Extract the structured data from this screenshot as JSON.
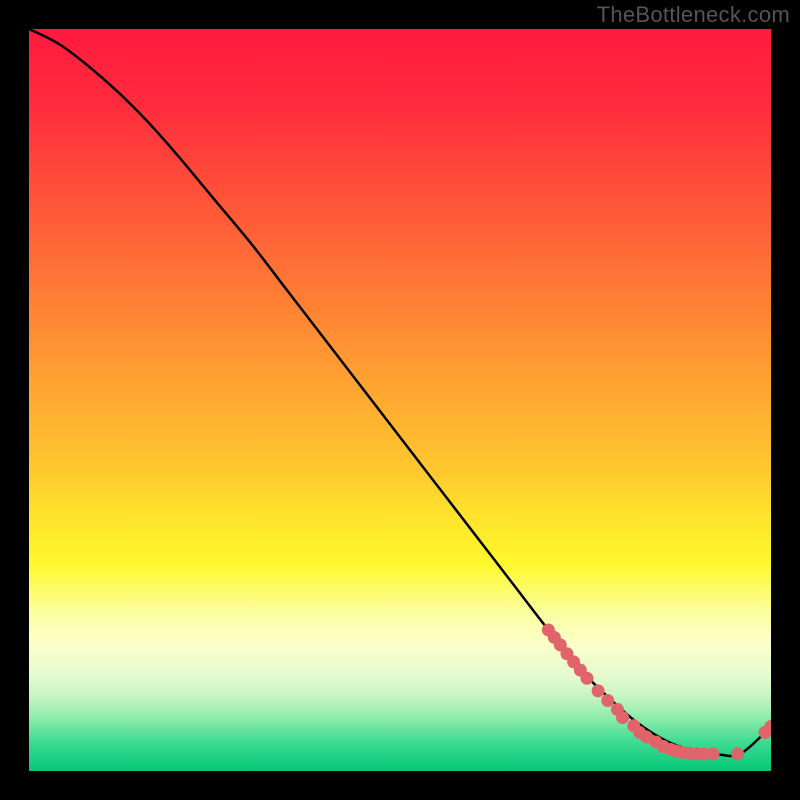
{
  "watermark": "TheBottleneck.com",
  "colors": {
    "background": "#000000",
    "curve": "#000000",
    "point": "#e0646a",
    "grad_stops": [
      {
        "offset": 0.0,
        "color": "#ff1a3f"
      },
      {
        "offset": 0.1,
        "color": "#ff2b3d"
      },
      {
        "offset": 0.2,
        "color": "#ff4a3a"
      },
      {
        "offset": 0.3,
        "color": "#ff6a37"
      },
      {
        "offset": 0.4,
        "color": "#ff8a34"
      },
      {
        "offset": 0.5,
        "color": "#ffaa31"
      },
      {
        "offset": 0.6,
        "color": "#ffca2e"
      },
      {
        "offset": 0.65,
        "color": "#ffe12c"
      },
      {
        "offset": 0.72,
        "color": "#fff82c"
      },
      {
        "offset": 0.79,
        "color": "#fbffa5"
      },
      {
        "offset": 0.83,
        "color": "#fbffca"
      },
      {
        "offset": 0.87,
        "color": "#e7fbd0"
      },
      {
        "offset": 0.9,
        "color": "#c6f5c2"
      },
      {
        "offset": 0.93,
        "color": "#8bebaa"
      },
      {
        "offset": 0.96,
        "color": "#3fdc92"
      },
      {
        "offset": 1.0,
        "color": "#05c779"
      }
    ]
  },
  "chart_data": {
    "type": "line",
    "title": "",
    "xlabel": "",
    "ylabel": "",
    "xlim": [
      0,
      100
    ],
    "ylim": [
      0,
      100
    ],
    "grid": false,
    "series": [
      {
        "name": "curve",
        "x": [
          0,
          4,
          8,
          12,
          16,
          20,
          25,
          30,
          35,
          40,
          45,
          50,
          55,
          60,
          65,
          70,
          74,
          78,
          82,
          86,
          90,
          93,
          96,
          100
        ],
        "values": [
          100,
          98,
          95,
          91.5,
          87.5,
          83,
          77,
          71,
          64.5,
          58,
          51.5,
          45,
          38.5,
          32,
          25.5,
          19,
          14,
          10,
          6.5,
          4,
          2.6,
          2.2,
          2.4,
          6
        ],
        "style": "line"
      },
      {
        "name": "points",
        "x": [
          70.0,
          70.8,
          71.6,
          72.5,
          73.4,
          74.3,
          75.2,
          76.7,
          78.0,
          79.3,
          80.0,
          81.5,
          82.3,
          83.2,
          84.5,
          85.5,
          86.5,
          87.2,
          88.0,
          89.0,
          90.0,
          91.0,
          92.2,
          95.5,
          99.2,
          100.0
        ],
        "values": [
          19.0,
          18.0,
          17.0,
          15.8,
          14.7,
          13.6,
          12.5,
          10.8,
          9.5,
          8.3,
          7.2,
          6.1,
          5.2,
          4.6,
          3.9,
          3.3,
          2.9,
          2.7,
          2.5,
          2.4,
          2.3,
          2.3,
          2.3,
          2.3,
          5.2,
          6.0
        ],
        "style": "scatter"
      }
    ]
  }
}
